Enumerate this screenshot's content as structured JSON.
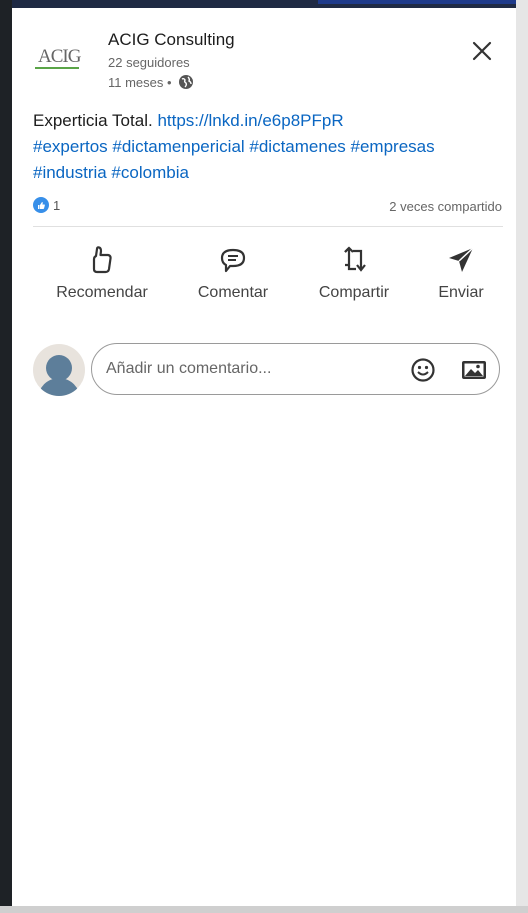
{
  "company": {
    "logo_text": "ACIG",
    "name": "ACIG Consulting",
    "followers": "22 seguidores",
    "time": "11 meses •"
  },
  "post": {
    "text": "Experticia Total.",
    "link": "https://lnkd.in/e6p8PFpR",
    "hashtags_line1": "#expertos #dictamenpericial #dictamenes #empresas",
    "hashtags_line2": "#industria #colombia"
  },
  "stats": {
    "reactions": "1",
    "shares": "2 veces compartido"
  },
  "actions": {
    "recommend": "Recomendar",
    "comment": "Comentar",
    "share": "Compartir",
    "send": "Enviar"
  },
  "comment": {
    "placeholder": "Añadir un comentario..."
  },
  "colors": {
    "link": "#0a66c2",
    "like_badge": "#378fe9"
  },
  "icons": [
    "close-icon",
    "globe-icon",
    "like-icon",
    "comment-icon",
    "repost-icon",
    "send-icon",
    "emoji-icon",
    "image-icon"
  ]
}
